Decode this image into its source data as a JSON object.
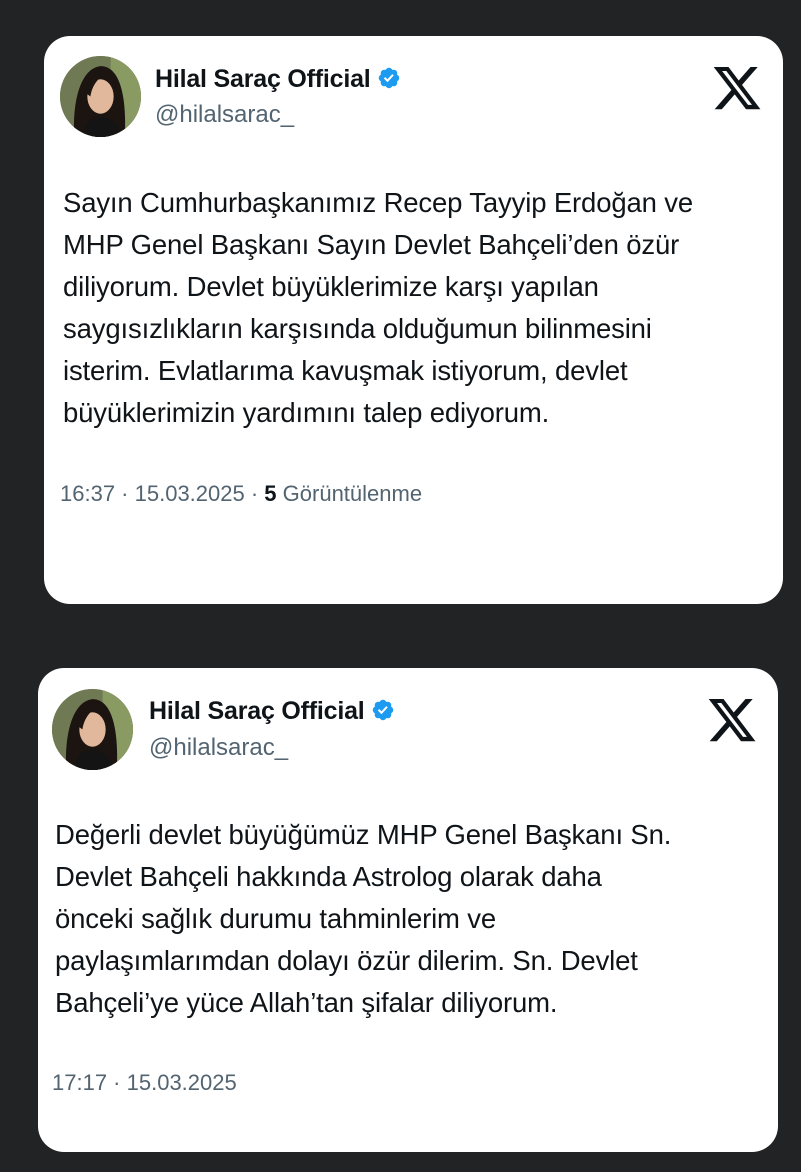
{
  "tweets": [
    {
      "display_name": "Hilal Saraç Official",
      "handle": "@hilalsarac_",
      "verified": true,
      "text_lines": [
        "Sayın Cumhurbaşkanımız Recep Tayyip Erdoğan ve",
        "MHP Genel Başkanı Sayın Devlet Bahçeli’den özür",
        "diliyorum. Devlet büyüklerimize karşı yapılan",
        "saygısızlıkların karşısında olduğumun bilinmesini",
        "isterim. Evlatlarıma kavuşmak istiyorum, devlet",
        "büyüklerimizin yardımını talep ediyorum."
      ],
      "time": "16:37",
      "separator": " · ",
      "date": "15.03.2025",
      "views_count": "5",
      "views_label": " Görüntülenme"
    },
    {
      "display_name": "Hilal Saraç Official",
      "handle": "@hilalsarac_",
      "verified": true,
      "text_lines": [
        "Değerli devlet büyüğümüz MHP Genel Başkanı Sn.",
        "Devlet Bahçeli hakkında Astrolog olarak daha",
        "önceki sağlık durumu tahminlerim ve",
        "paylaşımlarımdan dolayı özür dilerim. Sn. Devlet",
        "Bahçeli’ye yüce Allah’tan şifalar diliyorum."
      ],
      "time": "17:17",
      "separator": " · ",
      "date": "15.03.2025"
    }
  ],
  "icons": {
    "brand": "x-logo-icon",
    "verified": "verified-badge-icon"
  },
  "colors": {
    "background": "#222324",
    "card": "#ffffff",
    "text": "#0f1419",
    "secondary_text": "#536471",
    "verified_blue": "#1d9bf0"
  }
}
